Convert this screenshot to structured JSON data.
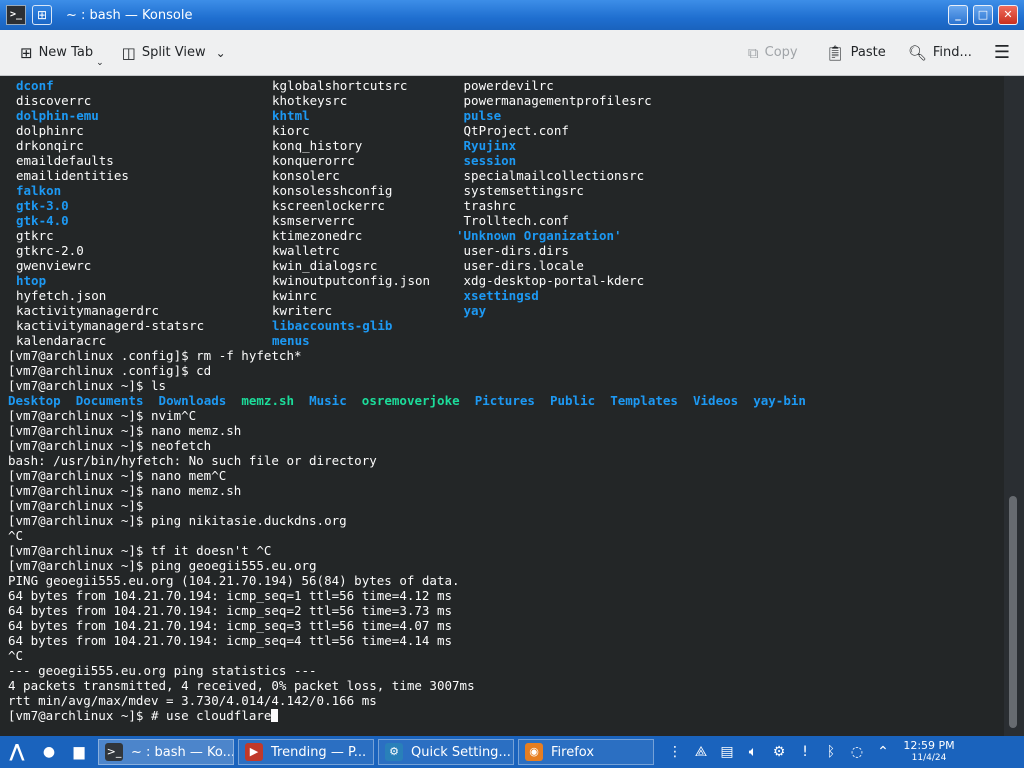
{
  "window": {
    "title": "~ : bash — Konsole"
  },
  "toolbar": {
    "new_tab": "New Tab",
    "split_view": "Split View",
    "copy": "Copy",
    "paste": "Paste",
    "find": "Find..."
  },
  "terminal": {
    "columns": [
      [
        {
          "t": "dconf",
          "c": "dir"
        },
        {
          "t": "discoverrc"
        },
        {
          "t": "dolphin-emu",
          "c": "dir"
        },
        {
          "t": "dolphinrc"
        },
        {
          "t": "drkonqirc"
        },
        {
          "t": "emaildefaults"
        },
        {
          "t": "emailidentities"
        },
        {
          "t": "falkon",
          "c": "dir"
        },
        {
          "t": "gtk-3.0",
          "c": "dir"
        },
        {
          "t": "gtk-4.0",
          "c": "dir"
        },
        {
          "t": "gtkrc"
        },
        {
          "t": "gtkrc-2.0"
        },
        {
          "t": "gwenviewrc"
        },
        {
          "t": "htop",
          "c": "dir"
        },
        {
          "t": "hyfetch.json"
        },
        {
          "t": "kactivitymanagerdrc"
        },
        {
          "t": "kactivitymanagerd-statsrc"
        },
        {
          "t": "kalendaracrc"
        }
      ],
      [
        {
          "t": "kglobalshortcutsrc"
        },
        {
          "t": "khotkeysrc"
        },
        {
          "t": "khtml",
          "c": "dir"
        },
        {
          "t": "kiorc"
        },
        {
          "t": "konq_history"
        },
        {
          "t": "konquerorrc"
        },
        {
          "t": "konsolerc"
        },
        {
          "t": "konsolesshconfig"
        },
        {
          "t": "kscreenlockerrc"
        },
        {
          "t": "ksmserverrc"
        },
        {
          "t": "ktimezonedrc"
        },
        {
          "t": "kwalletrc"
        },
        {
          "t": "kwin_dialogsrc"
        },
        {
          "t": "kwinoutputconfig.json"
        },
        {
          "t": "kwinrc"
        },
        {
          "t": "kwriterc"
        },
        {
          "t": "libaccounts-glib",
          "c": "dir"
        },
        {
          "t": "menus",
          "c": "dir"
        }
      ],
      [
        {
          "t": " powerdevilrc"
        },
        {
          "t": " powermanagementprofilesrc"
        },
        {
          "t": " pulse",
          "c": "dir"
        },
        {
          "t": " QtProject.conf"
        },
        {
          "t": " Ryujinx",
          "c": "dir"
        },
        {
          "t": " session",
          "c": "dir"
        },
        {
          "t": " specialmailcollectionsrc"
        },
        {
          "t": " systemsettingsrc"
        },
        {
          "t": " trashrc"
        },
        {
          "t": " Trolltech.conf"
        },
        {
          "t": "'Unknown Organization'",
          "c": "dir"
        },
        {
          "t": " user-dirs.dirs"
        },
        {
          "t": " user-dirs.locale"
        },
        {
          "t": " xdg-desktop-portal-kderc"
        },
        {
          "t": " xsettingsd",
          "c": "dir"
        },
        {
          "t": " yay",
          "c": "dir"
        }
      ]
    ],
    "history": [
      "[vm7@archlinux .config]$ rm -f hyfetch*",
      "[vm7@archlinux .config]$ cd",
      "[vm7@archlinux ~]$ ls",
      null,
      "[vm7@archlinux ~]$ nvim^C",
      "[vm7@archlinux ~]$ nano memz.sh",
      "[vm7@archlinux ~]$ neofetch",
      "bash: /usr/bin/hyfetch: No such file or directory",
      "[vm7@archlinux ~]$ nano mem^C",
      "[vm7@archlinux ~]$ nano memz.sh",
      "[vm7@archlinux ~]$",
      "[vm7@archlinux ~]$ ping nikitasie.duckdns.org",
      "^C",
      "[vm7@archlinux ~]$ tf it doesn't ^C",
      "[vm7@archlinux ~]$ ping geoegii555.eu.org",
      "PING geoegii555.eu.org (104.21.70.194) 56(84) bytes of data.",
      "64 bytes from 104.21.70.194: icmp_seq=1 ttl=56 time=4.12 ms",
      "64 bytes from 104.21.70.194: icmp_seq=2 ttl=56 time=3.73 ms",
      "64 bytes from 104.21.70.194: icmp_seq=3 ttl=56 time=4.07 ms",
      "64 bytes from 104.21.70.194: icmp_seq=4 ttl=56 time=4.14 ms",
      "^C",
      "--- geoegii555.eu.org ping statistics ---",
      "4 packets transmitted, 4 received, 0% packet loss, time 3007ms",
      "rtt min/avg/max/mdev = 3.730/4.014/4.142/0.166 ms"
    ],
    "ls_home": [
      {
        "t": "Desktop",
        "c": "dir"
      },
      {
        "t": "Documents",
        "c": "dir"
      },
      {
        "t": "Downloads",
        "c": "dir"
      },
      {
        "t": "memz.sh",
        "c": "exe"
      },
      {
        "t": "Music",
        "c": "dir"
      },
      {
        "t": "osremoverjoke",
        "c": "exe"
      },
      {
        "t": "Pictures",
        "c": "dir"
      },
      {
        "t": "Public",
        "c": "dir"
      },
      {
        "t": "Templates",
        "c": "dir"
      },
      {
        "t": "Videos",
        "c": "dir"
      },
      {
        "t": "yay-bin",
        "c": "dir"
      }
    ],
    "prompt_line": "[vm7@archlinux ~]$ # use cloudflare"
  },
  "taskbar": {
    "tasks": [
      {
        "label": "~ : bash — Ko...",
        "icon": "terminal-icon",
        "active": true
      },
      {
        "label": "Trending — P...",
        "icon": "browser-icon",
        "active": false
      },
      {
        "label": "Quick Setting...",
        "icon": "settings-icon",
        "active": false
      },
      {
        "label": "Firefox",
        "icon": "firefox-icon",
        "active": false
      }
    ],
    "clock_time": "12:59 PM",
    "clock_date": "11/4/24"
  },
  "colors": {
    "dir": "#1d99f3",
    "exe": "#1cdc9a",
    "terminal_bg": "#232627",
    "titlebar": "#1f6fd0",
    "taskbar": "#1a63bd"
  }
}
